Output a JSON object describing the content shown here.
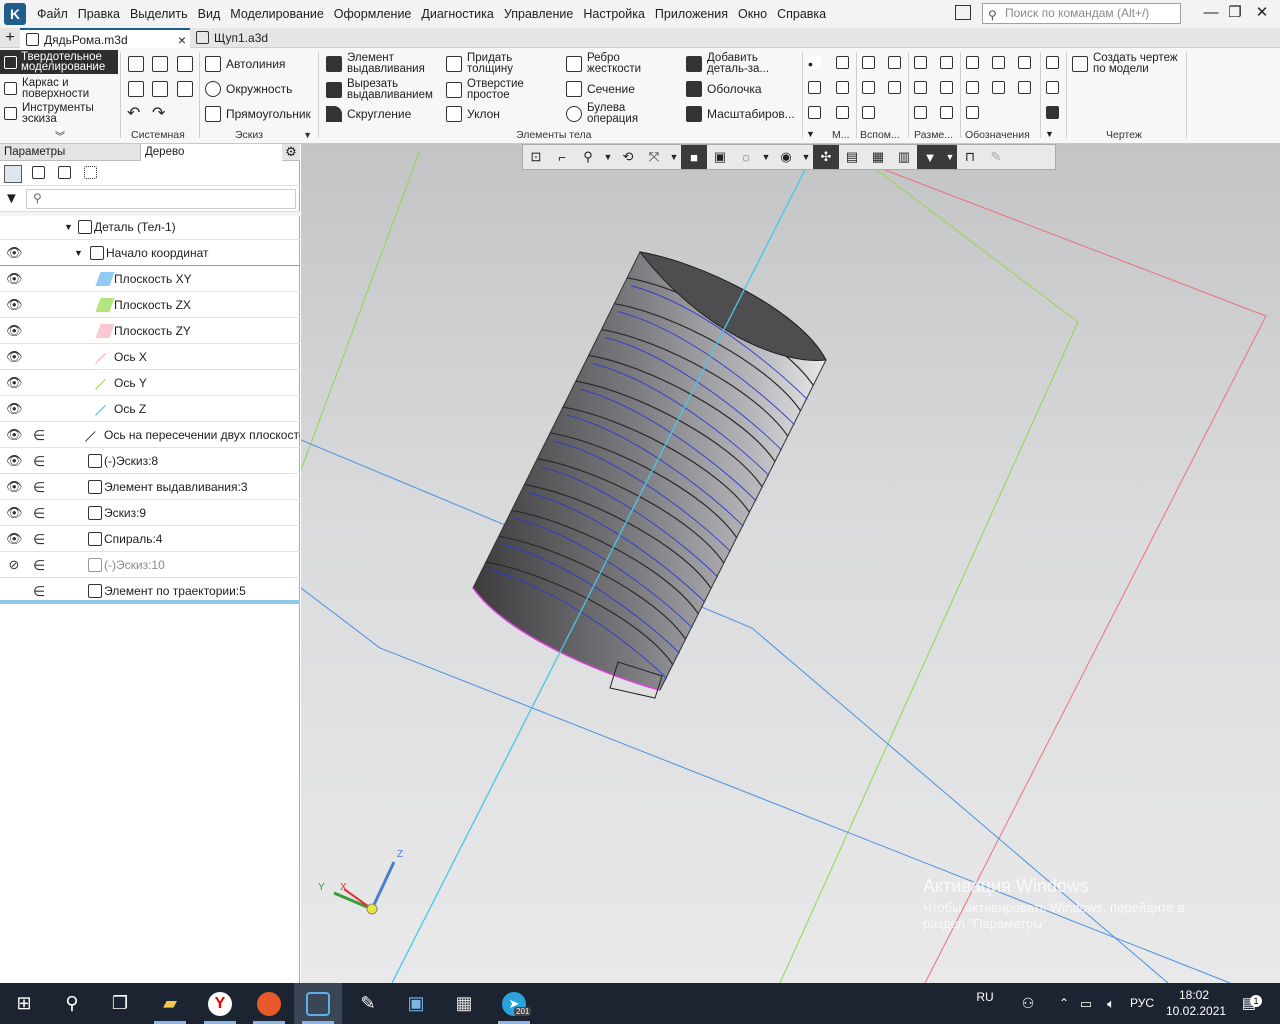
{
  "menubar": {
    "items": [
      "Файл",
      "Правка",
      "Выделить",
      "Вид",
      "Моделирование",
      "Оформление",
      "Диагностика",
      "Управление",
      "Настройка",
      "Приложения",
      "Окно",
      "Справка"
    ],
    "search_placeholder": "Поиск по командам (Alt+/)"
  },
  "tabs": [
    {
      "label": "ДядьРома.m3d",
      "active": true
    },
    {
      "label": "Щуп1.a3d",
      "active": false
    }
  ],
  "ribbon": {
    "modes": {
      "solid": "Твердотельное моделирование",
      "wire": "Каркас и поверхности",
      "sketch_tools": "Инструменты эскиза"
    },
    "sketch": {
      "autoline": "Автолиния",
      "circle": "Окружность",
      "rectangle": "Прямоугольник"
    },
    "body": {
      "extrude": "Элемент выдавливания",
      "cut_extrude": "Вырезать выдавливанием",
      "fillet": "Скругление",
      "thicken": "Придать толщину",
      "simple_hole": "Отверстие простое",
      "draft": "Уклон",
      "rib": "Ребро жесткости",
      "section": "Сечение",
      "boolean": "Булева операция",
      "add_part": "Добавить деталь-за...",
      "shell": "Оболочка",
      "scale": "Масштабиров..."
    },
    "drawing": {
      "create": "Создать чертеж по модели"
    },
    "groups": {
      "system": "Системная",
      "sketch": "Эскиз",
      "body": "Элементы тела",
      "m": "М...",
      "aux": "Вспом...",
      "dims": "Разме...",
      "notation": "Обозначения",
      "drawing": "Чертеж"
    }
  },
  "panel": {
    "tab_params": "Параметры",
    "tab_tree": "Дерево",
    "search_icon": "search-icon"
  },
  "tree": [
    {
      "label": "Деталь (Тел-1)",
      "visible": null
    },
    {
      "label": "Начало координат",
      "visible": true
    },
    {
      "label": "Плоскость XY",
      "visible": true
    },
    {
      "label": "Плоскость ZX",
      "visible": true
    },
    {
      "label": "Плоскость ZY",
      "visible": true
    },
    {
      "label": "Ось X",
      "visible": true
    },
    {
      "label": "Ось Y",
      "visible": true
    },
    {
      "label": "Ось Z",
      "visible": true
    },
    {
      "label": "Ось на пересечении двух плоскостей",
      "visible": true
    },
    {
      "label": "(-)Эскиз:8",
      "visible": true
    },
    {
      "label": "Элемент выдавливания:3",
      "visible": true
    },
    {
      "label": "Эскиз:9",
      "visible": true
    },
    {
      "label": "Спираль:4",
      "visible": true
    },
    {
      "label": "(-)Эскиз:10",
      "visible": false
    },
    {
      "label": "Элемент по траектории:5",
      "visible": null
    }
  ],
  "viewport": {
    "triad_labels": {
      "x": "X",
      "y": "Y",
      "z": "Z"
    },
    "watermark_title": "Активация Windows",
    "watermark_sub1": "Чтобы активировать Windows, перейдите в",
    "watermark_sub2": "раздел \"Параметры\"."
  },
  "colors": {
    "accent": "#1f5e8c",
    "plane_xy": "#4a90e2",
    "plane_zx": "#7ed321",
    "plane_zy": "#f0607a",
    "axis_z": "#40c8e6"
  },
  "taskbar": {
    "lang": "RU",
    "layout": "РУС",
    "time": "18:02",
    "date": "10.02.2021",
    "telegram_badge": "201",
    "notif_count": "1"
  }
}
